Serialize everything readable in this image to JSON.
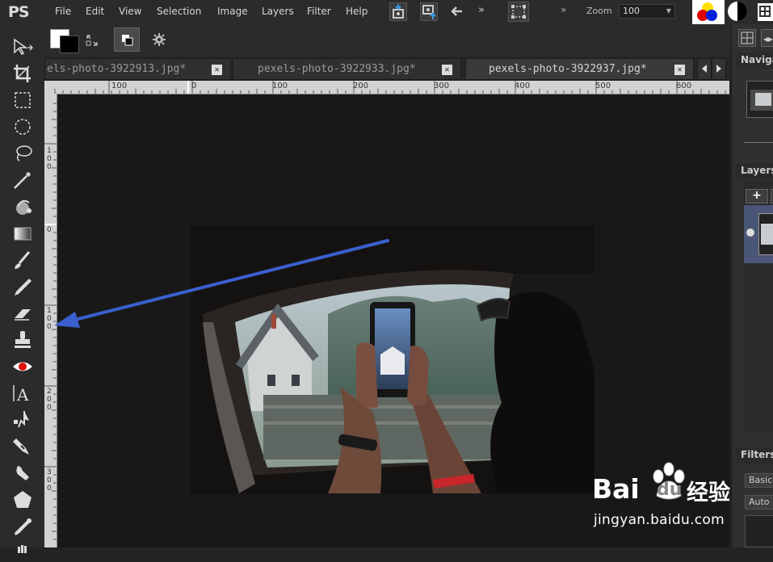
{
  "app": {
    "logo": "PS"
  },
  "menu": [
    "File",
    "Edit",
    "View",
    "Selection",
    "Image",
    "Layers",
    "Filter",
    "Help"
  ],
  "toolbar_top": {
    "zoom_label": "Zoom",
    "zoom_value": "100",
    "more_glyph": "»"
  },
  "tabs": [
    {
      "label": "els-photo-3922913.jpg*",
      "active": false
    },
    {
      "label": "pexels-photo-3922933.jpg*",
      "active": false
    },
    {
      "label": "pexels-photo-3922937.jpg*",
      "active": true
    }
  ],
  "ruler": {
    "h_labels": [
      "100",
      "0",
      "100",
      "200",
      "300",
      "400",
      "500",
      "600"
    ],
    "v_labels": [
      "1\n0\n0",
      "0",
      "1\n0\n0",
      "2\n0\n0",
      "3\n0\n0"
    ]
  },
  "right_panel": {
    "navigator": "Navigator",
    "layers": "Layers",
    "add_layer": "+",
    "filters": "Filters",
    "filter_basic": "Basic",
    "filter_auto": "Auto"
  },
  "watermark": {
    "brand": "Bai",
    "brand2": "du",
    "cn": "经验",
    "url": "jingyan.baidu.com"
  },
  "colors": {
    "accent_arrow": "#3a5fcf",
    "foreground": "#ffffff",
    "background": "#000000"
  }
}
